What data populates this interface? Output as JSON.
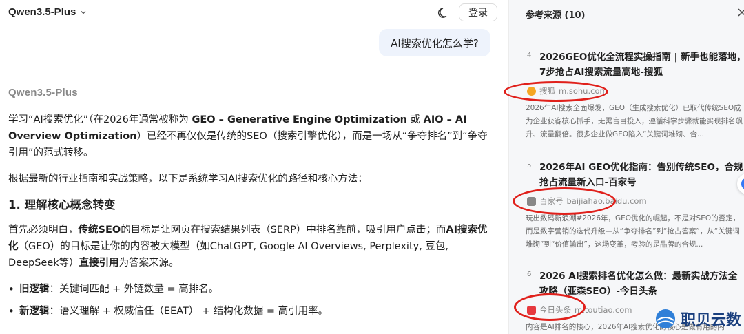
{
  "topbar": {
    "model_label": "Qwen3.5-Plus",
    "login_label": "登录"
  },
  "user_message": "AI搜索优化怎么学?",
  "assistant": {
    "name": "Qwen3.5-Plus",
    "intro_1": "学习“AI搜索优化”（在2026年通常被称为 ",
    "intro_bold_1": "GEO – Generative Engine Optimization",
    "intro_2": " 或 ",
    "intro_bold_2": "AIO – AI Overview Optimization",
    "intro_3": "）已经不再仅仅是传统的SEO（搜索引擎优化），而是一场从“争夺排名”到“争夺引用”的范式转移。",
    "para_2": "根据最新的行业指南和实战策略，以下是系统学习AI搜索优化的路径和核心方法：",
    "heading_1": "1. 理解核心概念转变",
    "para_3_a": "首先必须明白，",
    "para_3_b": "传统SEO",
    "para_3_c": "的目标是让网页在搜索结果列表（SERP）中排名靠前，吸引用户点击；而",
    "para_3_d": "AI搜索优化",
    "para_3_e": "（GEO）的目标是让你的内容被大模型（如ChatGPT, Google AI Overviews, Perplexity, 豆包, DeepSeek等）",
    "para_3_f": "直接引用",
    "para_3_g": "为答案来源。",
    "bullets": [
      {
        "label": "旧逻辑",
        "text": "：关键词匹配 + 外链数量 = 高排名。"
      },
      {
        "label": "新逻辑",
        "text": "：语义理解 + 权威信任（EEAT） + 结构化数据 = 高引用率。"
      }
    ]
  },
  "sources": {
    "header": "参考来源 (10)",
    "items": [
      {
        "num": "4",
        "title": "2026GEO优化全流程实操指南 | 新手也能落地，7步抢占AI搜索流量高地-搜狐",
        "site": "搜狐",
        "domain": "m.sohu.com",
        "snippet": "2026年AI搜索全面爆发，GEO（生成搜索优化）已取代传统SEO成为企业获客核心抓手，无需盲目投入，遵循科学步骤就能实现排名飙升、流量翻倍。很多企业做GEO陷入“关键词堆砌、合..."
      },
      {
        "num": "5",
        "title": "2026年AI GEO优化指南：告别传统SEO，合规抢占流量新入口-百家号",
        "site": "百家号",
        "domain": "baijiahao.baidu.com",
        "snippet": "玩出数码新浪潮#2026年，GEO优化的崛起，不是对SEO的否定，而是数字营销的迭代升级—从“争夺排名”到“抢占答案”，从“关键词堆砌”到“价值输出”，这场变革，考验的是品牌的合规..."
      },
      {
        "num": "6",
        "title": "2026 AI搜索排名优化怎么做：最新实战方法全攻略（亚森SEO）-今日头条",
        "site": "今日头条",
        "domain": "m.toutiao.com",
        "snippet": "内容是AI排名的核心，2026年AI搜索优化的核心是做有用的内"
      }
    ]
  },
  "watermark": "职贝云数",
  "colors": {
    "user_bubble": "#eef3fc",
    "panel_bg": "#f6f7f9",
    "annotation_red": "#e0201b",
    "favicon_sohu": "#f5a623",
    "favicon_baijiahao": "#888888",
    "favicon_toutiao": "#e6393e"
  }
}
